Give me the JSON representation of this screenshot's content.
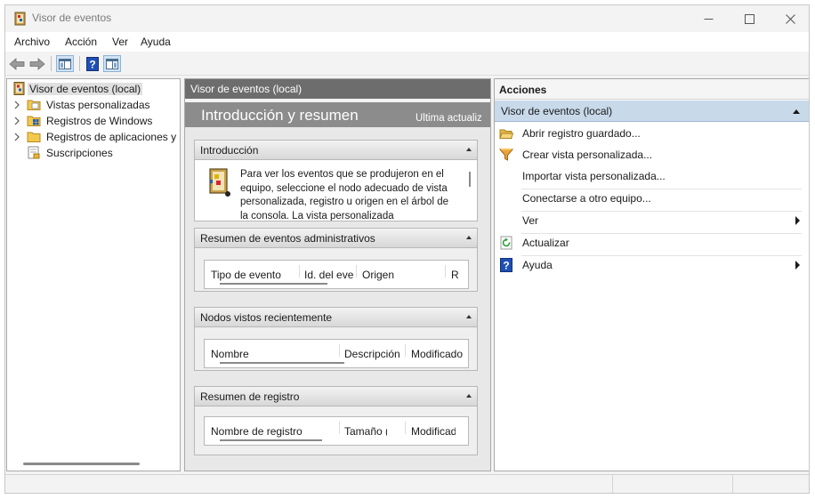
{
  "window": {
    "title": "Visor de eventos",
    "controls": [
      "minimize-icon",
      "maximize-icon",
      "close-icon"
    ]
  },
  "menubar": {
    "items": [
      "Archivo",
      "Acción",
      "Ver",
      "Ayuda"
    ]
  },
  "toolbar": {
    "buttons": [
      "back-arrow-icon",
      "forward-arrow-icon",
      "show-hide-tree-icon",
      "help-icon",
      "show-hide-action-pane-icon"
    ]
  },
  "tree": {
    "items": [
      {
        "label": "Visor de eventos (local)",
        "selected": true,
        "expandable": false,
        "icon": "event-viewer-icon"
      },
      {
        "label": "Vistas personalizadas",
        "expandable": true,
        "icon": "folder-icon"
      },
      {
        "label": "Registros de Windows",
        "expandable": true,
        "icon": "windows-logs-folder-icon"
      },
      {
        "label": "Registros de aplicaciones y servicios",
        "expandable": true,
        "icon": "folder-icon"
      },
      {
        "label": "Suscripciones",
        "expandable": false,
        "icon": "subscriptions-icon"
      }
    ]
  },
  "middle": {
    "header": "Visor de eventos (local)",
    "banner_title": "Introducción y resumen",
    "banner_subtitle": "Última actualización",
    "sections": [
      {
        "title": "Introducción",
        "text": "Para ver los eventos que se produjeron en el equipo, seleccione el nodo adecuado de vista personalizada, registro u origen en el árbol de la consola. La vista personalizada"
      },
      {
        "title": "Resumen de eventos administrativos",
        "columns": [
          "Tipo de evento",
          "Id. del evento",
          "Origen",
          "Registro"
        ]
      },
      {
        "title": "Nodos vistos recientemente",
        "columns": [
          "Nombre",
          "Descripción",
          "Modificado"
        ]
      },
      {
        "title": "Resumen de registro",
        "columns": [
          "Nombre de registro",
          "Tamaño (actual/máximo)",
          "Modificado"
        ]
      }
    ]
  },
  "actions": {
    "header": "Acciones",
    "group": "Visor de eventos (local)",
    "items": [
      {
        "label": "Abrir registro guardado...",
        "icon": "open-folder-icon",
        "submenu": false
      },
      {
        "label": "Crear vista personalizada...",
        "icon": "filter-icon",
        "submenu": false
      },
      {
        "label": "Importar vista personalizada...",
        "icon": "",
        "submenu": false
      },
      {
        "label": "Conectarse a otro equipo...",
        "icon": "",
        "submenu": false
      },
      {
        "label": "Ver",
        "icon": "",
        "submenu": true
      },
      {
        "label": "Actualizar",
        "icon": "refresh-icon",
        "submenu": false
      },
      {
        "label": "Ayuda",
        "icon": "help-icon",
        "submenu": true
      }
    ]
  },
  "colors": {
    "title_text": "#7a7a7a",
    "pane_header_bg": "#6d6d6d",
    "banner_bg": "#8c8c8c",
    "actions_group_bg": "#c8d9ea",
    "help_blue": "#1f4fb4"
  }
}
